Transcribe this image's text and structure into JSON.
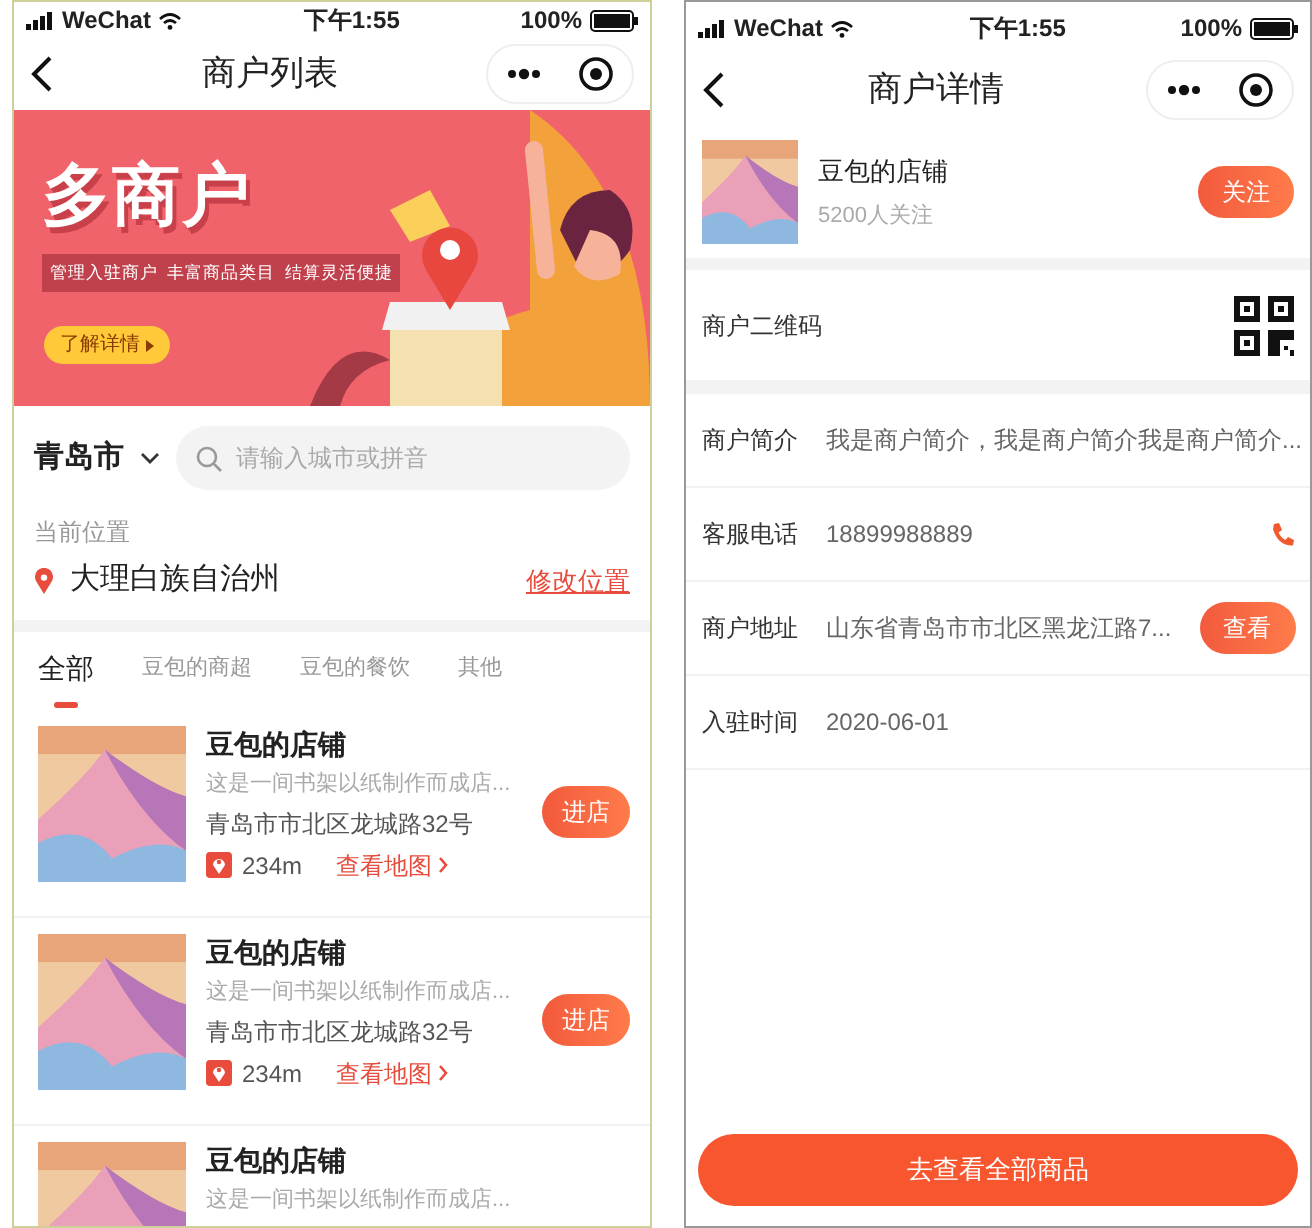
{
  "list_screen": {
    "status_bar": {
      "carrier": "WeChat",
      "time": "下午1:55",
      "battery": "100%"
    },
    "nav": {
      "title": "商户列表"
    },
    "banner": {
      "headline": "多商户",
      "tagline": "管理入驻商户  丰富商品类目  结算灵活便捷",
      "button": "了解详情"
    },
    "city": {
      "name": "青岛市"
    },
    "search": {
      "placeholder": "请输入城市或拼音"
    },
    "location": {
      "label": "当前位置",
      "place": "大理白族自治州",
      "action": "修改位置"
    },
    "tabs": [
      {
        "label": "全部",
        "selected": true
      },
      {
        "label": "豆包的商超",
        "selected": false
      },
      {
        "label": "豆包的餐饮",
        "selected": false
      },
      {
        "label": "其他",
        "selected": false
      }
    ],
    "stores": [
      {
        "name": "豆包的店铺",
        "desc": "这是一间书架以纸制作而成店...",
        "address": "青岛市市北区龙城路32号",
        "distance": "234m",
        "map_link": "查看地图",
        "button": "进店"
      },
      {
        "name": "豆包的店铺",
        "desc": "这是一间书架以纸制作而成店...",
        "address": "青岛市市北区龙城路32号",
        "distance": "234m",
        "map_link": "查看地图",
        "button": "进店"
      },
      {
        "name": "豆包的店铺",
        "desc": "这是一间书架以纸制作而成店..."
      }
    ]
  },
  "detail_screen": {
    "status_bar": {
      "carrier": "WeChat",
      "time": "下午1:55",
      "battery": "100%"
    },
    "nav": {
      "title": "商户详情"
    },
    "header": {
      "name": "豆包的店铺",
      "followers": "5200人关注",
      "button": "关注"
    },
    "qr_row": {
      "label": "商户二维码"
    },
    "info_rows": [
      {
        "kind": "text",
        "label": "商户简介",
        "value": "我是商户简介，我是商户简介我是商户简介..."
      },
      {
        "kind": "phone",
        "label": "客服电话",
        "value": "18899988889"
      },
      {
        "kind": "address",
        "label": "商户地址",
        "value": "山东省青岛市市北区黑龙江路7...",
        "button": "查看"
      },
      {
        "kind": "text",
        "label": "入驻时间",
        "value": "2020-06-01"
      }
    ],
    "bottom_button": "去查看全部商品"
  }
}
